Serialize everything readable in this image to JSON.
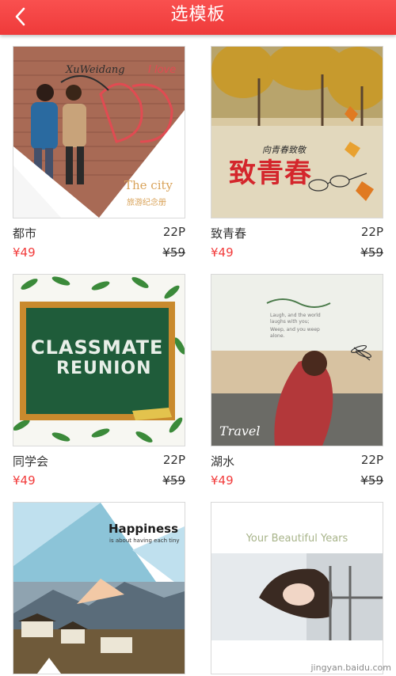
{
  "header": {
    "title": "选模板",
    "back_icon": "chevron-left-icon"
  },
  "templates": [
    {
      "name": "都市",
      "pages": "22P",
      "price": "¥49",
      "original_price": "¥59",
      "cover_texts": [
        "XuWeidang",
        "I love",
        "The city",
        "旅游纪念册"
      ]
    },
    {
      "name": "致青春",
      "pages": "22P",
      "price": "¥49",
      "original_price": "¥59",
      "cover_texts": [
        "向青春致敬",
        "致青春"
      ]
    },
    {
      "name": "同学会",
      "pages": "22P",
      "price": "¥49",
      "original_price": "¥59",
      "cover_texts": [
        "CLASSMATE",
        "REUNION"
      ]
    },
    {
      "name": "湖水",
      "pages": "22P",
      "price": "¥49",
      "original_price": "¥59",
      "cover_texts": [
        "Travel",
        "Laugh, and the world laughs with you;",
        "Weep, and you weep alone."
      ]
    },
    {
      "name": "",
      "pages": "",
      "price": "",
      "original_price": "",
      "cover_texts": [
        "Happiness",
        "is about having each tiny"
      ]
    },
    {
      "name": "",
      "pages": "",
      "price": "",
      "original_price": "",
      "cover_texts": [
        "Your Beautiful Years"
      ]
    }
  ],
  "watermark": "jingyan.baidu.com",
  "colors": {
    "header": "#f24646",
    "price": "#f23b3b"
  }
}
